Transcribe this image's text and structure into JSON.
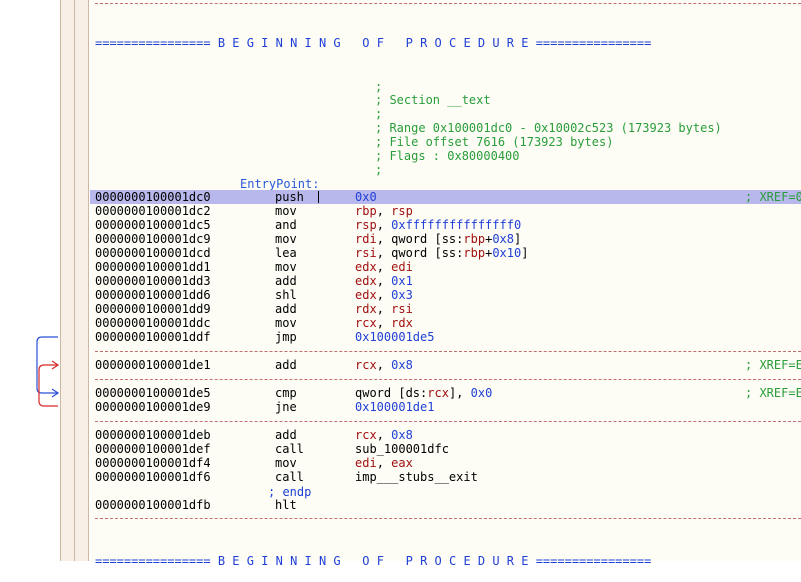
{
  "banner_text": "================ B E G I N N I N G   O F   P R O C E D U R E ================",
  "section_comments": [
    ";",
    "; Section __text",
    ";",
    "; Range 0x100001dc0 - 0x10002c523 (173923 bytes)",
    "; File offset 7616 (173923 bytes)",
    "; Flags : 0x80000400",
    ";"
  ],
  "entry_label": "EntryPoint:",
  "endp_label": "; endp",
  "xref_text": "; XREF=E",
  "xref_text_first": "; XREF=0",
  "instructions": [
    {
      "addr": "0000000100001dc0",
      "mn": "push",
      "ops": [
        {
          "t": "0x0",
          "c": "num"
        }
      ],
      "xref": true,
      "hl": true
    },
    {
      "addr": "0000000100001dc2",
      "mn": "mov",
      "ops": [
        {
          "t": "rbp",
          "c": "reg"
        },
        {
          "t": ", ",
          "c": ""
        },
        {
          "t": "rsp",
          "c": "reg"
        }
      ]
    },
    {
      "addr": "0000000100001dc5",
      "mn": "and",
      "ops": [
        {
          "t": "rsp",
          "c": "reg"
        },
        {
          "t": ", ",
          "c": ""
        },
        {
          "t": "0xfffffffffffffff0",
          "c": "num"
        }
      ]
    },
    {
      "addr": "0000000100001dc9",
      "mn": "mov",
      "ops": [
        {
          "t": "rdi",
          "c": "reg"
        },
        {
          "t": ", qword [ss:",
          "c": ""
        },
        {
          "t": "rbp",
          "c": "reg"
        },
        {
          "t": "+",
          "c": ""
        },
        {
          "t": "0x8",
          "c": "num"
        },
        {
          "t": "]",
          "c": ""
        }
      ]
    },
    {
      "addr": "0000000100001dcd",
      "mn": "lea",
      "ops": [
        {
          "t": "rsi",
          "c": "reg"
        },
        {
          "t": ", qword [ss:",
          "c": ""
        },
        {
          "t": "rbp",
          "c": "reg"
        },
        {
          "t": "+",
          "c": ""
        },
        {
          "t": "0x10",
          "c": "num"
        },
        {
          "t": "]",
          "c": ""
        }
      ]
    },
    {
      "addr": "0000000100001dd1",
      "mn": "mov",
      "ops": [
        {
          "t": "edx",
          "c": "reg"
        },
        {
          "t": ", ",
          "c": ""
        },
        {
          "t": "edi",
          "c": "reg"
        }
      ]
    },
    {
      "addr": "0000000100001dd3",
      "mn": "add",
      "ops": [
        {
          "t": "edx",
          "c": "reg"
        },
        {
          "t": ", ",
          "c": ""
        },
        {
          "t": "0x1",
          "c": "num"
        }
      ]
    },
    {
      "addr": "0000000100001dd6",
      "mn": "shl",
      "ops": [
        {
          "t": "edx",
          "c": "reg"
        },
        {
          "t": ", ",
          "c": ""
        },
        {
          "t": "0x3",
          "c": "num"
        }
      ]
    },
    {
      "addr": "0000000100001dd9",
      "mn": "add",
      "ops": [
        {
          "t": "rdx",
          "c": "reg"
        },
        {
          "t": ", ",
          "c": ""
        },
        {
          "t": "rsi",
          "c": "reg"
        }
      ]
    },
    {
      "addr": "0000000100001ddc",
      "mn": "mov",
      "ops": [
        {
          "t": "rcx",
          "c": "reg"
        },
        {
          "t": ", ",
          "c": ""
        },
        {
          "t": "rdx",
          "c": "reg"
        }
      ]
    },
    {
      "addr": "0000000100001ddf",
      "mn": "jmp",
      "ops": [
        {
          "t": "0x100001de5",
          "c": "num"
        }
      ]
    },
    {
      "addr": "0000000100001de1",
      "mn": "add",
      "ops": [
        {
          "t": "rcx",
          "c": "reg"
        },
        {
          "t": ", ",
          "c": ""
        },
        {
          "t": "0x8",
          "c": "num"
        }
      ],
      "xref": true
    },
    {
      "addr": "0000000100001de5",
      "mn": "cmp",
      "ops": [
        {
          "t": "qword [ds:",
          "c": ""
        },
        {
          "t": "rcx",
          "c": "reg"
        },
        {
          "t": "], ",
          "c": ""
        },
        {
          "t": "0x0",
          "c": "num"
        }
      ],
      "xref": true
    },
    {
      "addr": "0000000100001de9",
      "mn": "jne",
      "ops": [
        {
          "t": "0x100001de1",
          "c": "num"
        }
      ]
    },
    {
      "addr": "0000000100001deb",
      "mn": "add",
      "ops": [
        {
          "t": "rcx",
          "c": "reg"
        },
        {
          "t": ", ",
          "c": ""
        },
        {
          "t": "0x8",
          "c": "num"
        }
      ]
    },
    {
      "addr": "0000000100001def",
      "mn": "call",
      "ops": [
        {
          "t": "sub_100001dfc",
          "c": ""
        }
      ]
    },
    {
      "addr": "0000000100001df4",
      "mn": "mov",
      "ops": [
        {
          "t": "edi",
          "c": "reg"
        },
        {
          "t": ", ",
          "c": ""
        },
        {
          "t": "eax",
          "c": "reg"
        }
      ]
    },
    {
      "addr": "0000000100001df6",
      "mn": "call",
      "ops": [
        {
          "t": "imp___stubs__exit",
          "c": ""
        }
      ]
    },
    {
      "addr": "0000000100001dfb",
      "mn": "hlt",
      "ops": []
    }
  ],
  "colors": {
    "highlight": "#b8b8ec",
    "comment": "#2a9d3a",
    "number": "#1f3fd6",
    "register": "#a01010",
    "arrow_blue": "#2a4fd6",
    "arrow_red": "#d62a2a"
  }
}
